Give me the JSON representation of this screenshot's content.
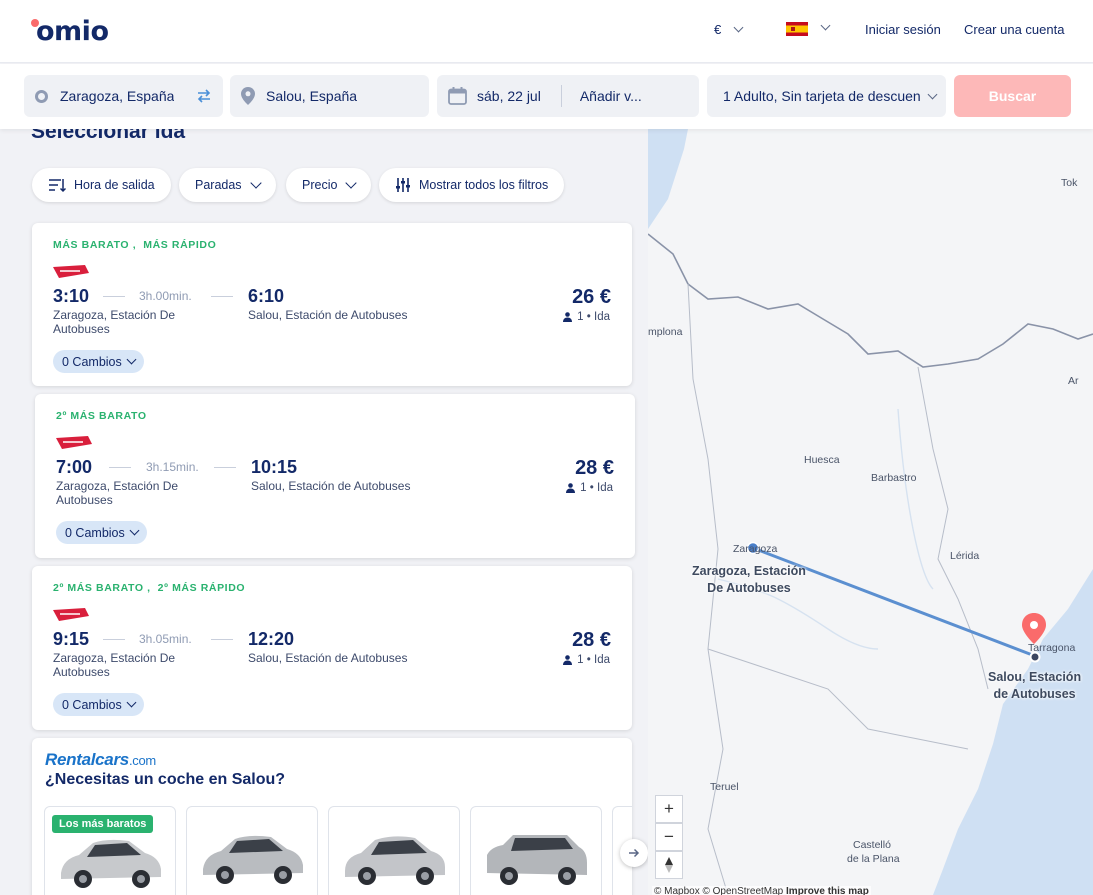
{
  "header": {
    "brand": "omio",
    "currency": "€",
    "login": "Iniciar sesión",
    "register": "Crear una cuenta"
  },
  "search": {
    "origin": "Zaragoza, España",
    "destination": "Salou, España",
    "date": "sáb, 22 jul",
    "return": "Añadir v...",
    "passengers": "1 Adulto, Sin tarjeta de descuen",
    "button": "Buscar"
  },
  "results": {
    "title": "Seleccionar ida",
    "filters": [
      "Hora de salida",
      "Paradas",
      "Precio",
      "Mostrar todos los filtros"
    ],
    "trips": [
      {
        "tags": [
          "MÁS BARATO",
          "MÁS RÁPIDO"
        ],
        "departure": "3:10",
        "duration": "3h.00min.",
        "arrival": "6:10",
        "from": "Zaragoza, Estación De Autobuses",
        "to": "Salou, Estación de Autobuses",
        "price": "26 €",
        "pax": "1",
        "trip_type": "• Ida",
        "changes": "0 Cambios"
      },
      {
        "tags": [
          "2º MÁS BARATO"
        ],
        "departure": "7:00",
        "duration": "3h.15min.",
        "arrival": "10:15",
        "from": "Zaragoza, Estación De Autobuses",
        "to": "Salou, Estación de Autobuses",
        "price": "28 €",
        "pax": "1",
        "trip_type": "• Ida",
        "changes": "0 Cambios"
      },
      {
        "tags": [
          "2º MÁS BARATO",
          "2º MÁS RÁPIDO"
        ],
        "departure": "9:15",
        "duration": "3h.05min.",
        "arrival": "12:20",
        "from": "Zaragoza, Estación De Autobuses",
        "to": "Salou, Estación de Autobuses",
        "price": "28 €",
        "pax": "1",
        "trip_type": "• Ida",
        "changes": "0 Cambios"
      }
    ]
  },
  "rental": {
    "logo": "Rentalcars",
    "logo_suffix": ".com",
    "title": "¿Necesitas un coche en Salou?",
    "badge": "Los más baratos"
  },
  "map": {
    "labels": [
      "Tok",
      "mplona",
      "Huesca",
      "Barbastro",
      "Zaragoza",
      "Lérida",
      "Tarragona",
      "Teruel",
      "Castelló",
      "de la Plana",
      "Ar"
    ],
    "origin_label": [
      "Zaragoza, Estación",
      "De Autobuses"
    ],
    "destination_label": [
      "Salou, Estación",
      "de Autobuses"
    ],
    "zoom_in": "+",
    "zoom_out": "−",
    "attribution_a": "© Mapbox © OpenStreetMap ",
    "attribution_b": "Improve this map"
  },
  "colors": {
    "brand_navy": "#132968",
    "brand_coral": "#fa6b6b",
    "tag_green": "#2ab26f",
    "button_disabled": "#fdb8b8",
    "route_blue": "#5b8fd0",
    "sea_blue": "#cfe0f3"
  }
}
